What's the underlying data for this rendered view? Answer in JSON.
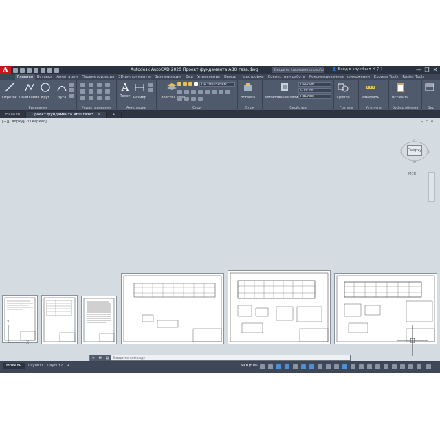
{
  "window": {
    "app_logo": "A",
    "title": "Autodesk AutoCAD 2020  Проект фундамента АВО газа.dwg",
    "search_placeholder": "Введите ключевое слово/фразу",
    "signin": "Вход в службы",
    "controls": [
      "—",
      "❐",
      "✕"
    ]
  },
  "ribbon": {
    "tabs": [
      {
        "label": "Главная",
        "active": true
      },
      {
        "label": "Вставка"
      },
      {
        "label": "Аннотации"
      },
      {
        "label": "Параметризация"
      },
      {
        "label": "3D инструменты"
      },
      {
        "label": "Визуализация"
      },
      {
        "label": "Вид"
      },
      {
        "label": "Управление"
      },
      {
        "label": "Вывод"
      },
      {
        "label": "Надстройки"
      },
      {
        "label": "Совместная работа"
      },
      {
        "label": "Рекомендованные приложения"
      },
      {
        "label": "Express Tools"
      },
      {
        "label": "Raster Tools"
      }
    ],
    "groups": {
      "draw": {
        "label": "Рисование",
        "tools": [
          "Отрезок",
          "Полилиния",
          "Круг",
          "Дуга"
        ]
      },
      "modify": {
        "label": "Редактирование"
      },
      "annotation": {
        "label": "Аннотации",
        "tools": [
          "Текст",
          "Размер"
        ]
      },
      "layers": {
        "label": "Слои",
        "tool": "Свойства слоя",
        "current_layer": "По умолчанию"
      },
      "block": {
        "label": "Блок",
        "tool": "Вставка"
      },
      "properties": {
        "label": "Свойства",
        "tool": "Копирование свойств",
        "color": "ПоСлою",
        "lineweight": "0.00 мм",
        "linetype": "ПоСлою"
      },
      "groups": {
        "label": "Группы",
        "tool": "Группа"
      },
      "utilities": {
        "label": "Утилиты",
        "tool": "Измерить"
      },
      "clipboard": {
        "label": "Буфер обмена",
        "tool": "Вставить"
      },
      "view": {
        "label": "Вид"
      }
    }
  },
  "file_tabs": [
    {
      "label": "Начало"
    },
    {
      "label": "Проект фундамента АВО газа*",
      "active": true
    }
  ],
  "viewport": {
    "controls_label": "[−][Сверху][2D каркас]",
    "viewcube_face": "Сверху",
    "wcs_label": "МСК",
    "ucs_x": "X",
    "ucs_y": "Y"
  },
  "command_line": {
    "placeholder": "Введите команду"
  },
  "status": {
    "layout_tabs": [
      {
        "label": "Модель",
        "active": true
      },
      {
        "label": "Layout1"
      },
      {
        "label": "Layout2"
      }
    ],
    "model_label": "МОДЕЛЬ"
  },
  "colors": {
    "app_frame": "#3b4453",
    "ribbon": "#4f5a6c",
    "viewport_bg": "#d5dce1",
    "autocad_red": "#c8161d",
    "status_active": "#4d90d8"
  }
}
